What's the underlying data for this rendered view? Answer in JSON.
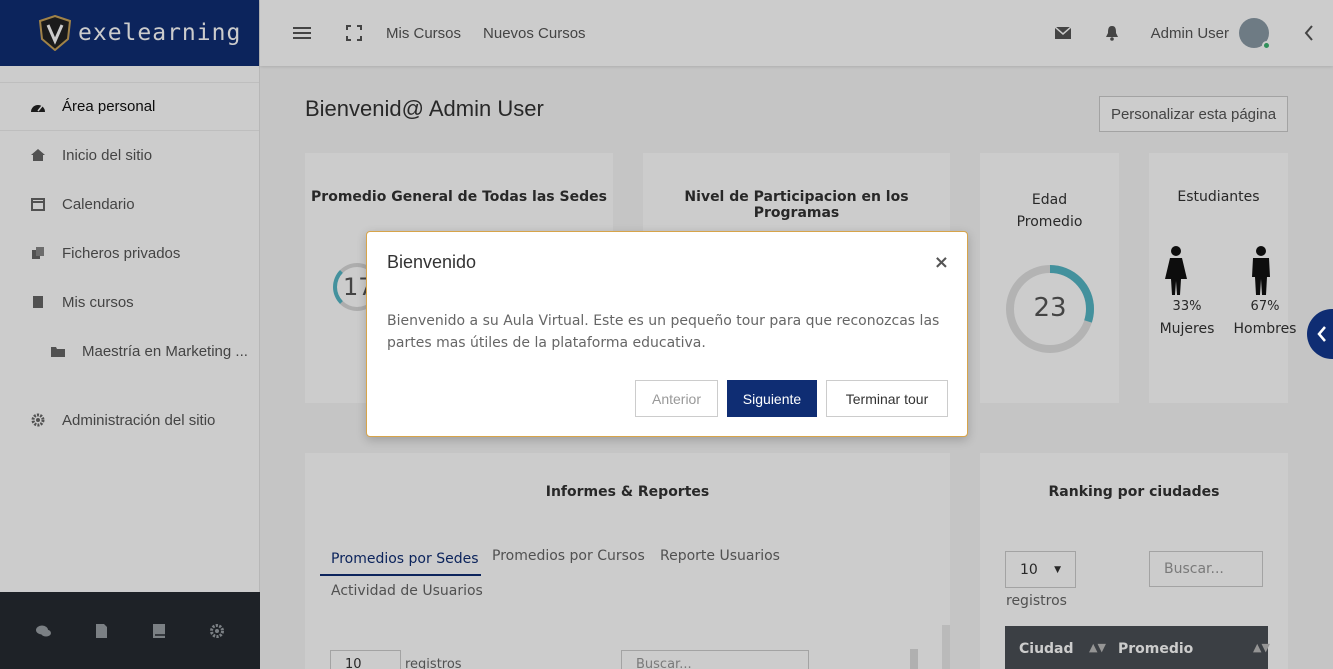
{
  "brand": {
    "name": "exelearning",
    "accent": "#0f2d73"
  },
  "sidebar": {
    "items": [
      {
        "label": "Área personal",
        "icon": "dashboard-icon",
        "active": true
      },
      {
        "label": "Inicio del sitio",
        "icon": "home-icon"
      },
      {
        "label": "Calendario",
        "icon": "calendar-icon"
      },
      {
        "label": "Ficheros privados",
        "icon": "files-icon"
      },
      {
        "label": "Mis cursos",
        "icon": "book-icon"
      },
      {
        "label": "Maestría en Marketing ...",
        "icon": "folder-icon"
      },
      {
        "label": "Administración del sitio",
        "icon": "gear-icon"
      }
    ],
    "footer_icons": [
      "chat-icon",
      "document-icon",
      "book-icon",
      "gear-icon"
    ]
  },
  "header": {
    "links": [
      "Mis Cursos",
      "Nuevos Cursos"
    ],
    "user": "Admin User"
  },
  "main": {
    "title": "Bienvenid@ Admin User",
    "customize_label": "Personalizar esta página",
    "cards": {
      "promedio": {
        "title": "Promedio General de Todas las Sedes",
        "value": "17"
      },
      "participacion": {
        "title": "Nivel de Participacion en los Programas"
      },
      "edad": {
        "title_line1": "Edad",
        "title_line2": "Promedio",
        "value": "23",
        "fill": 0.3
      },
      "estudiantes": {
        "title": "Estudiantes",
        "women_pct": "33%",
        "women_label": "Mujeres",
        "men_pct": "67%",
        "men_label": "Hombres"
      }
    },
    "reports": {
      "title": "Informes & Reportes",
      "tabs": [
        "Promedios por Sedes",
        "Promedios por Cursos",
        "Reporte Usuarios",
        "Actividad de Usuarios"
      ],
      "page_size": "10",
      "records_label": "registros",
      "search_placeholder": "Buscar..."
    },
    "ranking": {
      "title": "Ranking por ciudades",
      "page_size": "10",
      "records_label": "registros",
      "search_placeholder": "Buscar...",
      "columns": [
        "Ciudad",
        "Promedio"
      ]
    }
  },
  "tour": {
    "title": "Bienvenido",
    "close": "×",
    "body": "Bienvenido a su Aula Virtual. Este es un pequeño tour para que reconozcas las partes mas útiles de la plataforma educativa.",
    "prev": "Anterior",
    "next": "Siguiente",
    "end": "Terminar tour"
  }
}
